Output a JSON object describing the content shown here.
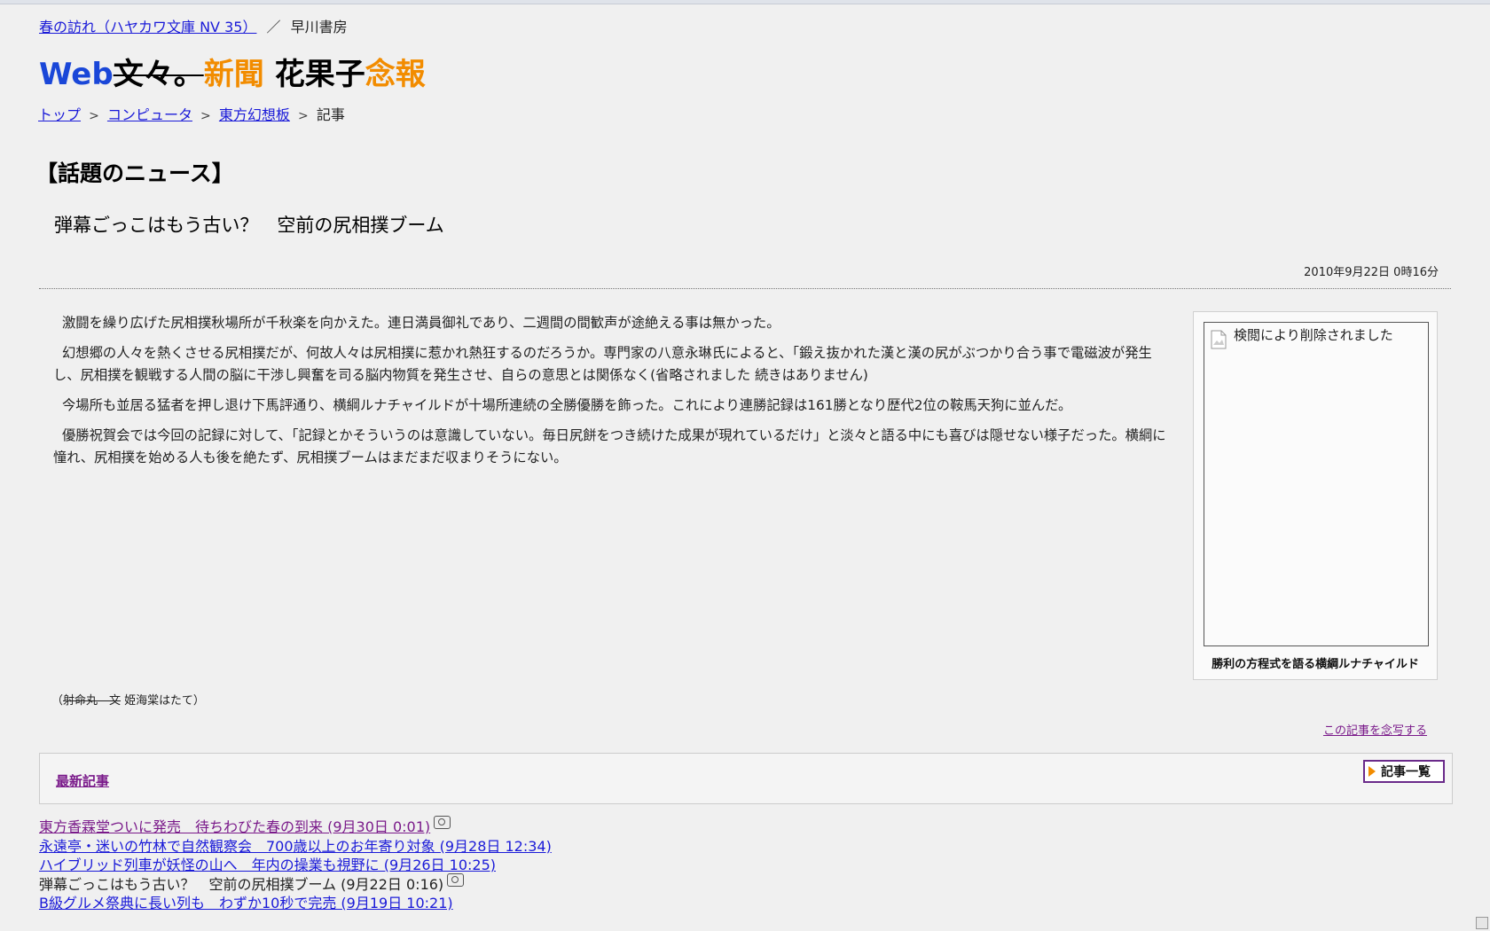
{
  "top_breadcrumb": {
    "link": "春の訪れ（ハヤカワ文庫 NV 35）",
    "sep": "／",
    "publisher": "早川書房"
  },
  "logo": {
    "web": "Web",
    "bunbun": "文々。",
    "shinbun": "新聞",
    "kakashi": "花果子",
    "nenpo": "念報"
  },
  "breadcrumbs": {
    "top": "トップ",
    "computer": "コンピュータ",
    "board": "東方幻想板",
    "current": "記事",
    "gt": ">"
  },
  "section_title": "【話題のニュース】",
  "article": {
    "title": "弾幕ごっこはもう古い？　空前の尻相撲ブーム",
    "date": "2010年9月22日 0時16分",
    "paragraphs": [
      "激闘を繰り広げた尻相撲秋場所が千秋楽を向かえた。連日満員御礼であり、二週間の間歓声が途絶える事は無かった。",
      "幻想郷の人々を熱くさせる尻相撲だが、何故人々は尻相撲に惹かれ熱狂するのだろうか。専門家の八意永琳氏によると、「鍛え抜かれた漢と漢の尻がぶつかり合う事で電磁波が発生し、尻相撲を観戦する人間の脳に干渉し興奮を司る脳内物質を発生させ、自らの意思とは関係なく(省略されました 続きはありません)",
      "今場所も並居る猛者を押し退け下馬評通り、横綱ルナチャイルドが十場所連続の全勝優勝を飾った。これにより連勝記録は161勝となり歴代2位の鞍馬天狗に並んだ。",
      "優勝祝賀会では今回の記録に対して、「記録とかそういうのは意識していない。毎日尻餅をつき続けた成果が現れているだけ」と淡々と語る中にも喜びは隠せない様子だった。横綱に憧れ、尻相撲を始める人も後を絶たず、尻相撲ブームはまだまだ収まりそうにない。"
    ],
    "photo_alt": "検閲により削除されました",
    "photo_caption": "勝利の方程式を語る横綱ルナチャイルド",
    "byline_open": "（",
    "byline_struck": "射命丸　文",
    "byline_name": " 姫海棠はたて）",
    "print_link": "この記事を念写する"
  },
  "latest": {
    "label": "最新記事",
    "list_button": "記事一覧"
  },
  "news_list": [
    {
      "text": "東方香霖堂ついに発売　待ちわびた春の到来 (9月30日 0:01)",
      "camera": true,
      "link": true,
      "visited": true
    },
    {
      "text": "永遠亭・迷いの竹林で自然観察会　700歳以上のお年寄り対象 (9月28日 12:34)",
      "camera": false,
      "link": true,
      "visited": false
    },
    {
      "text": "ハイブリッド列車が妖怪の山へ　年内の操業も視野に (9月26日 10:25)",
      "camera": false,
      "link": true,
      "visited": false
    },
    {
      "text": "弾幕ごっこはもう古い？　空前の尻相撲ブーム (9月22日 0:16)",
      "camera": true,
      "link": false,
      "visited": false
    },
    {
      "text": "B級グルメ祭典に長い列も　わずか10秒で完売 (9月19日 10:21)",
      "camera": false,
      "link": true,
      "visited": false
    }
  ]
}
